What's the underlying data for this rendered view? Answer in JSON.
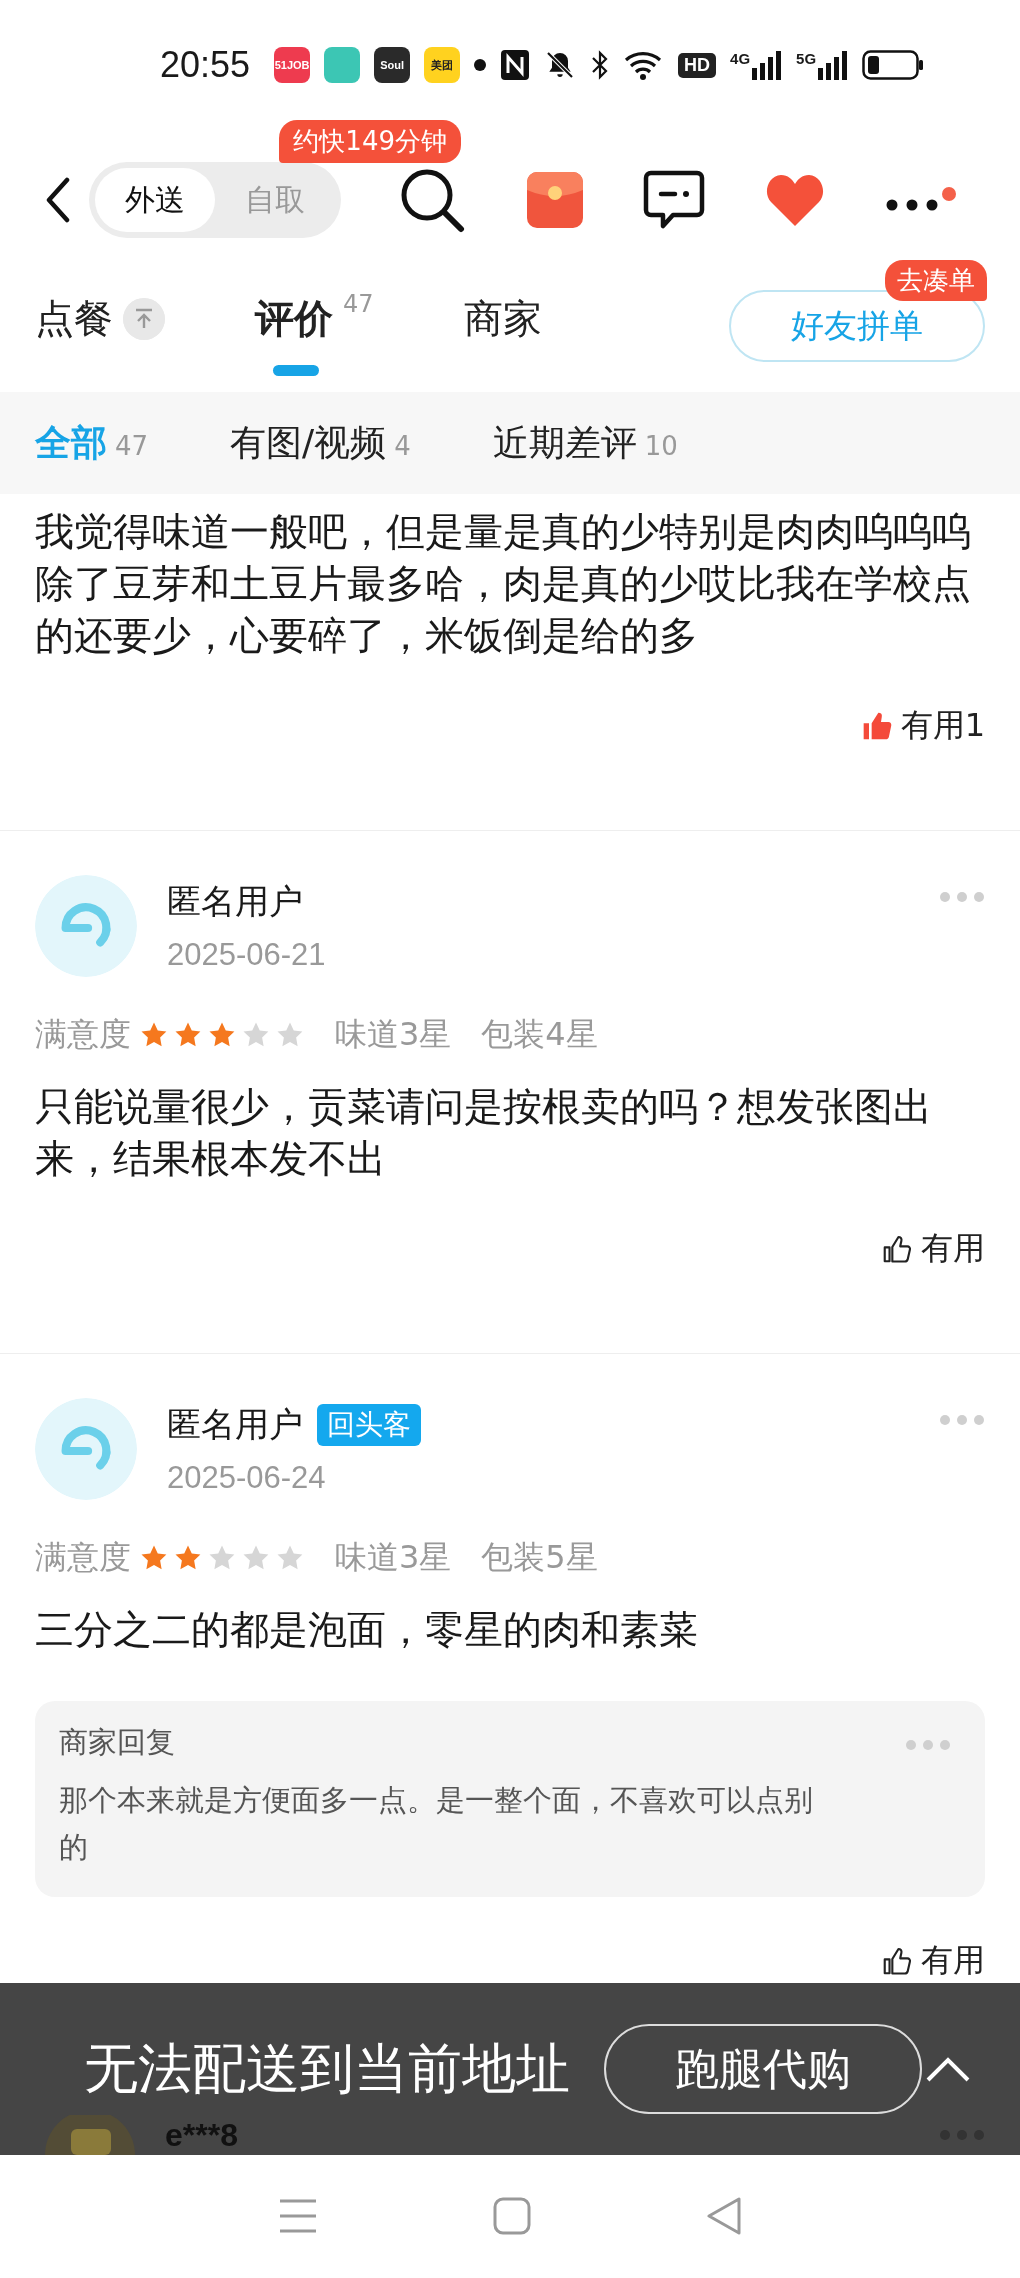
{
  "status_bar": {
    "time": "20:55",
    "app_icons": [
      {
        "label": "51JOB",
        "color": "#ee3b4f"
      },
      {
        "color": "#3cc6b4"
      },
      {
        "label": "Soul",
        "color": "#2a2a2a"
      },
      {
        "label": "美团",
        "color": "#ffd21f"
      }
    ],
    "hd_label": "HD",
    "network": [
      {
        "label": "4G"
      },
      {
        "label": "5G"
      }
    ]
  },
  "nav": {
    "delivery_modes": [
      {
        "label": "外送",
        "selected": true
      },
      {
        "label": "自取",
        "selected": false
      }
    ],
    "eta_badge": "约快149分钟"
  },
  "tabs": [
    {
      "label": "点餐",
      "selected": false,
      "kind": "pin"
    },
    {
      "label": "评价",
      "selected": true,
      "count": "47"
    },
    {
      "label": "商家",
      "selected": false
    }
  ],
  "group_order": {
    "label": "好友拼单",
    "badge": "去凑单"
  },
  "filters": [
    {
      "label": "全部",
      "count": "47",
      "selected": true
    },
    {
      "label": "有图/视频",
      "count": "4",
      "selected": false
    },
    {
      "label": "近期差评",
      "count": "10",
      "selected": false
    }
  ],
  "reviews": [
    {
      "kind": "partial",
      "text": "我觉得味道一般吧，但是量是真的少特别是肉肉呜呜呜除了豆芽和土豆片最多哈，肉是真的少哎比我在学校点的还要少，心要碎了，米饭倒是给的多",
      "helpful": {
        "label": "有用1",
        "liked": true
      }
    },
    {
      "kind": "full",
      "user": "匿名用户",
      "date": "2025-06-21",
      "rating_label": "满意度",
      "stars": 3,
      "taste": "味道3星",
      "packaging": "包装4星",
      "text": "只能说量很少，贡菜请问是按根卖的吗？想发张图出来，结果根本发不出",
      "helpful": {
        "label": "有用",
        "liked": false
      }
    },
    {
      "kind": "full",
      "user": "匿名用户",
      "tag": "回头客",
      "date": "2025-06-24",
      "rating_label": "满意度",
      "stars": 2,
      "taste": "味道3星",
      "packaging": "包装5星",
      "text": "三分之二的都是泡面，零星的肉和素菜",
      "merchant_reply": {
        "title": "商家回复",
        "text": "那个本来就是方便面多一点。是一整个面，不喜欢可以点别的"
      },
      "helpful": {
        "label": "有用",
        "liked": false
      }
    }
  ],
  "bottom_bar": {
    "message": "无法配送到当前地址",
    "button": "跑腿代购",
    "next_user": "e***8"
  }
}
